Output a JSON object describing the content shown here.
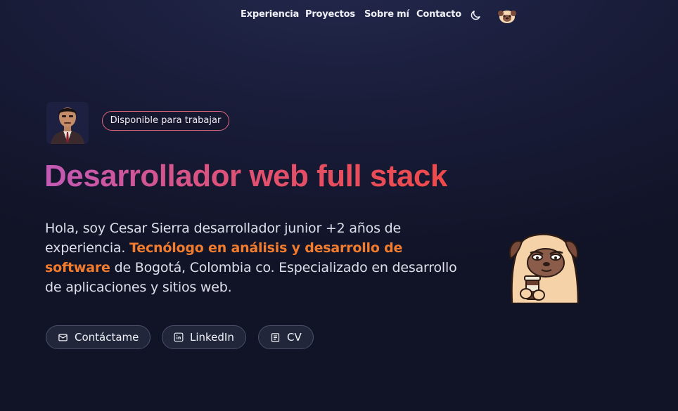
{
  "nav": {
    "links": [
      {
        "label": "Experiencia"
      },
      {
        "label": "Proyectos"
      },
      {
        "label": "Sobre mí"
      },
      {
        "label": "Contacto"
      }
    ],
    "theme_icon": "moon-icon",
    "mascot_icon": "pug-icon"
  },
  "hero": {
    "badge": "Disponible para trabajar",
    "headline": "Desarrollador web full stack",
    "bio_part1": "Hola, soy Cesar Sierra desarrollador junior +2 años de experiencia.",
    "bio_highlight": "Tecnólogo en análisis y desarrollo de software",
    "bio_part2": "de Bogotá, Colombia co. Especializado en desarrollo de aplicaciones y sitios web."
  },
  "buttons": [
    {
      "label": "Contáctame",
      "icon": "mail-icon"
    },
    {
      "label": "LinkedIn",
      "icon": "linkedin-icon"
    },
    {
      "label": "CV",
      "icon": "document-icon"
    }
  ],
  "colors": {
    "headline_gradient_start": "#c25ab6",
    "headline_gradient_end": "#ee4a4a",
    "highlight": "#f27c2e",
    "badge_border": "#e0677e",
    "background": "#1a1d3a"
  }
}
